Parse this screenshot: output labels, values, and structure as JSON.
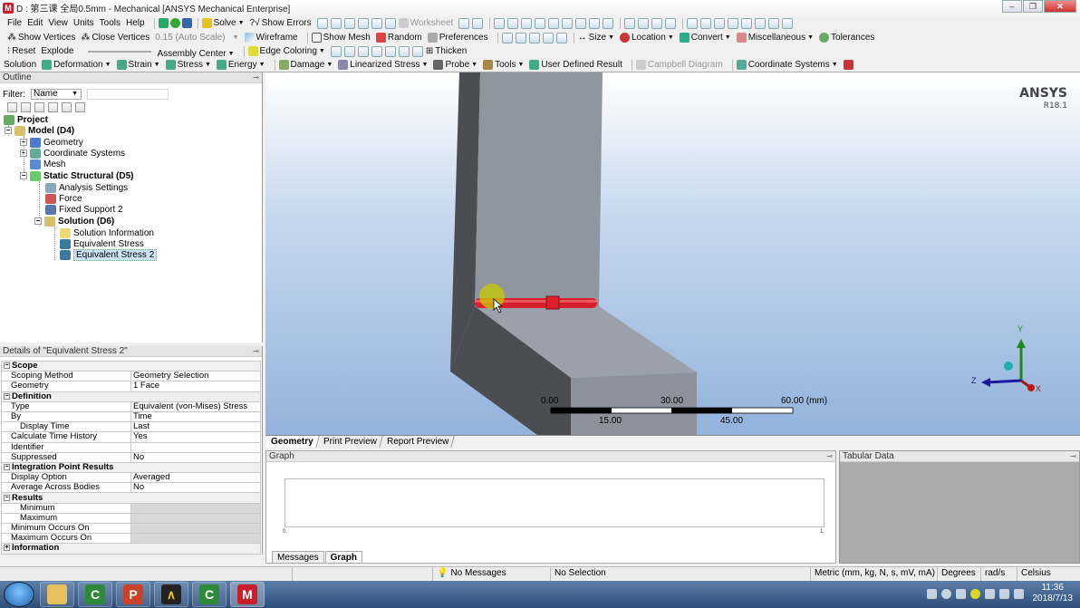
{
  "window": {
    "title": "D : 第三课 全局0.5mm - Mechanical [ANSYS Mechanical Enterprise]",
    "app_icon_letter": "M"
  },
  "menu": [
    "File",
    "Edit",
    "View",
    "Units",
    "Tools",
    "Help"
  ],
  "toolbar1": {
    "solve": "Solve",
    "show_errors": "Show Errors",
    "worksheet": "Worksheet"
  },
  "toolbar2": {
    "show_vertices": "Show Vertices",
    "close_vertices": "Close Vertices",
    "auto_scale": "0.15 (Auto Scale)",
    "wireframe": "Wireframe",
    "show_mesh": "Show Mesh",
    "random": "Random",
    "preferences": "Preferences",
    "size": "Size",
    "location": "Location",
    "convert": "Convert",
    "miscellaneous": "Miscellaneous",
    "tolerances": "Tolerances"
  },
  "toolbar3": {
    "reset": "Reset",
    "explode": "Explode",
    "assembly_center": "Assembly Center",
    "edge_coloring": "Edge Coloring",
    "thicken": "Thicken"
  },
  "toolbar4": {
    "solution": "Solution",
    "deformation": "Deformation",
    "strain": "Strain",
    "stress": "Stress",
    "energy": "Energy",
    "damage": "Damage",
    "linearized_stress": "Linearized Stress",
    "probe": "Probe",
    "tools": "Tools",
    "user_defined_result": "User Defined Result",
    "campbell_diagram": "Campbell Diagram",
    "coordinate_systems": "Coordinate Systems"
  },
  "outline": {
    "title": "Outline",
    "filter_label": "Filter:",
    "filter_value": "Name",
    "tree": [
      {
        "label": "Project",
        "bold": true
      },
      {
        "label": "Model (D4)",
        "bold": true
      },
      {
        "label": "Geometry"
      },
      {
        "label": "Coordinate Systems"
      },
      {
        "label": "Mesh"
      },
      {
        "label": "Static Structural (D5)",
        "bold": true
      },
      {
        "label": "Analysis Settings"
      },
      {
        "label": "Force"
      },
      {
        "label": "Fixed Support 2"
      },
      {
        "label": "Solution (D6)",
        "bold": true
      },
      {
        "label": "Solution Information"
      },
      {
        "label": "Equivalent Stress"
      },
      {
        "label": "Equivalent Stress 2"
      }
    ]
  },
  "details": {
    "title": "Details of \"Equivalent Stress 2\"",
    "groups": {
      "scope": "Scope",
      "definition": "Definition",
      "integration": "Integration Point Results",
      "results": "Results",
      "information": "Information"
    },
    "rows": {
      "scoping_method": {
        "k": "Scoping Method",
        "v": "Geometry Selection"
      },
      "geometry": {
        "k": "Geometry",
        "v": "1 Face"
      },
      "type": {
        "k": "Type",
        "v": "Equivalent (von-Mises) Stress"
      },
      "by": {
        "k": "By",
        "v": "Time"
      },
      "display_time": {
        "k": "Display Time",
        "v": "Last"
      },
      "calc_history": {
        "k": "Calculate Time History",
        "v": "Yes"
      },
      "identifier": {
        "k": "Identifier",
        "v": ""
      },
      "suppressed": {
        "k": "Suppressed",
        "v": "No"
      },
      "display_option": {
        "k": "Display Option",
        "v": "Averaged"
      },
      "avg_across": {
        "k": "Average Across Bodies",
        "v": "No"
      },
      "minimum": {
        "k": "Minimum",
        "v": ""
      },
      "maximum": {
        "k": "Maximum",
        "v": ""
      },
      "min_occurs": {
        "k": "Minimum Occurs On",
        "v": ""
      },
      "max_occurs": {
        "k": "Maximum Occurs On",
        "v": ""
      }
    }
  },
  "viewport": {
    "logo": "ANSYS",
    "version": "R18.1",
    "scale": {
      "l0": "0.00",
      "l30": "30.00",
      "l60": "60.00 (mm)",
      "l15": "15.00",
      "l45": "45.00"
    },
    "axes": {
      "x": "X",
      "y": "Y",
      "z": "Z"
    }
  },
  "view_tabs": [
    "Geometry",
    "Print Preview",
    "Report Preview"
  ],
  "graph": {
    "title": "Graph",
    "tick_min": "0.",
    "tick_max": "1.",
    "tabs": [
      "Messages",
      "Graph"
    ]
  },
  "tabular": {
    "title": "Tabular Data"
  },
  "status": {
    "messages": "No Messages",
    "selection": "No Selection",
    "units": "Metric (mm, kg, N, s, mV, mA)",
    "angle": "Degrees",
    "rate": "rad/s",
    "temp": "Celsius"
  },
  "taskbar": {
    "time": "11:36",
    "date": "2018/7/13"
  }
}
